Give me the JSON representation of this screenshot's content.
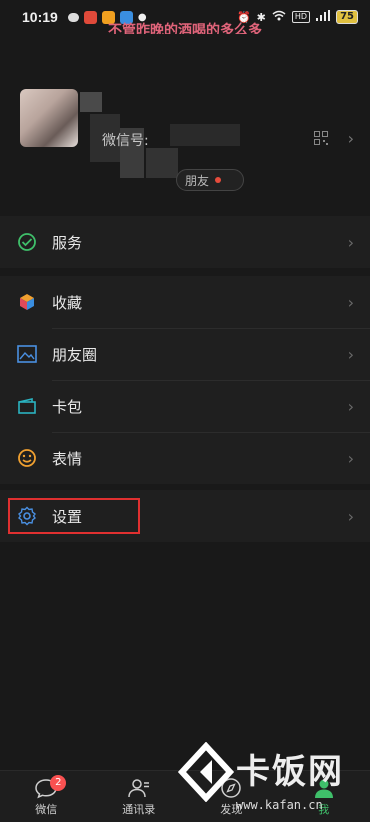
{
  "status_bar": {
    "time": "10:19",
    "battery": "75",
    "hd": "HD"
  },
  "overlay_caption": "不管昨晚的酒喝的多么多",
  "profile": {
    "wxid_label": "微信号:",
    "status_label": "朋友"
  },
  "menu": {
    "services": {
      "label": "服务",
      "icon": "wechat-pay-icon"
    },
    "group2": [
      {
        "label": "收藏",
        "icon": "favorites-cube-icon"
      },
      {
        "label": "朋友圈",
        "icon": "moments-picture-icon"
      },
      {
        "label": "卡包",
        "icon": "card-wallet-icon"
      },
      {
        "label": "表情",
        "icon": "smiley-face-icon"
      }
    ],
    "settings": {
      "label": "设置",
      "icon": "gear-icon"
    }
  },
  "tab_bar": {
    "tabs": [
      {
        "label": "微信",
        "badge": "2"
      },
      {
        "label": "通讯录"
      },
      {
        "label": "发现"
      },
      {
        "label": "我"
      }
    ]
  },
  "watermark": {
    "title": "卡饭网",
    "url": "www.kafan.cn"
  },
  "colors": {
    "background": "#191919",
    "accent_green": "#3fbf6a",
    "highlight_red": "#e03030",
    "badge_red": "#fa5151"
  }
}
